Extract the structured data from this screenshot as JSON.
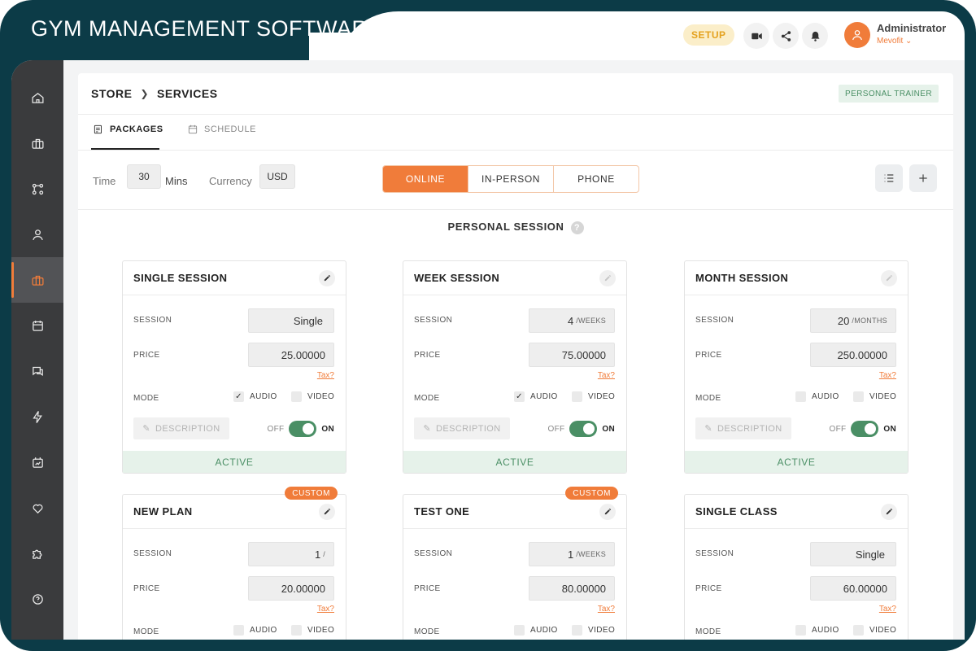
{
  "app": {
    "title": "GYM MANAGEMENT SOFTWARE"
  },
  "topbar": {
    "setup_label": "SETUP",
    "icons": [
      "video-icon",
      "share-icon",
      "bell-icon"
    ],
    "user": {
      "name": "Administrator",
      "org": "Mevofit"
    }
  },
  "sidebar": {
    "items": [
      {
        "icon": "home-icon"
      },
      {
        "icon": "briefcase-icon"
      },
      {
        "icon": "apps-icon"
      },
      {
        "icon": "user-icon"
      },
      {
        "icon": "store-icon",
        "active": true
      },
      {
        "icon": "calendar-icon"
      },
      {
        "icon": "chat-icon"
      },
      {
        "icon": "lightning-icon"
      },
      {
        "icon": "analytics-icon"
      },
      {
        "icon": "heart-icon"
      },
      {
        "icon": "puzzle-icon"
      },
      {
        "icon": "help-icon"
      }
    ]
  },
  "breadcrumb": {
    "root": "STORE",
    "current": "SERVICES"
  },
  "badge": "PERSONAL TRAINER",
  "tabs": [
    {
      "label": "PACKAGES",
      "active": true
    },
    {
      "label": "SCHEDULE",
      "active": false
    }
  ],
  "filters": {
    "time_label": "Time",
    "time_value": "30",
    "time_unit": "Mins",
    "currency_label": "Currency",
    "currency_value": "USD"
  },
  "modes": [
    {
      "label": "ONLINE",
      "active": true
    },
    {
      "label": "IN-PERSON",
      "active": false
    },
    {
      "label": "PHONE",
      "active": false
    }
  ],
  "section": {
    "title": "PERSONAL SESSION",
    "help": "?"
  },
  "labels": {
    "session": "SESSION",
    "price": "PRICE",
    "mode": "MODE",
    "tax": "Tax?",
    "audio": "AUDIO",
    "video": "VIDEO",
    "description": "DESCRIPTION",
    "off": "OFF",
    "on": "ON",
    "active": "ACTIVE",
    "custom": "CUSTOM"
  },
  "cards": [
    {
      "title": "SINGLE SESSION",
      "session_value": "Single",
      "session_unit": "",
      "price": "25.00000",
      "audio": true,
      "video": false,
      "custom": false,
      "edit_faded": false
    },
    {
      "title": "WEEK SESSION",
      "session_value": "4",
      "session_unit": "/WEEKS",
      "price": "75.00000",
      "audio": true,
      "video": false,
      "custom": false,
      "edit_faded": true
    },
    {
      "title": "MONTH SESSION",
      "session_value": "20",
      "session_unit": "/MONTHS",
      "price": "250.00000",
      "audio": false,
      "video": false,
      "custom": false,
      "edit_faded": true
    },
    {
      "title": "NEW PLAN",
      "session_value": "1",
      "session_unit": "/",
      "price": "20.00000",
      "audio": false,
      "video": false,
      "custom": true,
      "edit_faded": false
    },
    {
      "title": "TEST ONE",
      "session_value": "1",
      "session_unit": "/WEEKS",
      "price": "80.00000",
      "audio": false,
      "video": false,
      "custom": true,
      "edit_faded": false
    },
    {
      "title": "SINGLE CLASS",
      "session_value": "Single",
      "session_unit": "",
      "price": "60.00000",
      "audio": false,
      "video": false,
      "custom": false,
      "edit_faded": false
    }
  ]
}
